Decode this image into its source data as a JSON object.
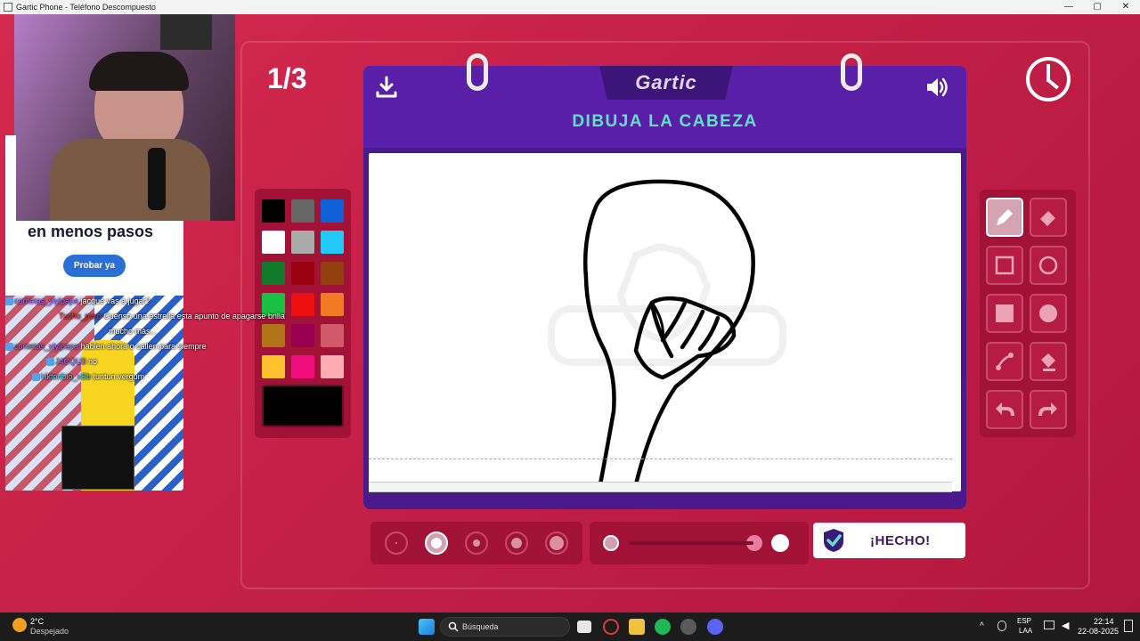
{
  "window": {
    "title": "Gartic Phone - Teléfono Descompuesto",
    "minimize": "—",
    "maximize": "▢",
    "close": "✕"
  },
  "game": {
    "round": "1/3",
    "logo": "Gartic",
    "prompt": "DIBUJA LA CABEZA",
    "done_label": "¡HECHO!",
    "colors": {
      "palette": [
        "#000000",
        "#666666",
        "#1060d8",
        "#ffffff",
        "#aaaaaa",
        "#22c8f8",
        "#117a2a",
        "#990010",
        "#92400e",
        "#19c042",
        "#ee1010",
        "#f37a24",
        "#b07318",
        "#9a0050",
        "#d05a6a",
        "#fdc22c",
        "#f00d7d",
        "#fdacb4"
      ],
      "selected": "#000000",
      "accent": "#c41f49",
      "prompt_color": "#61e0c8"
    },
    "tools": [
      "pencil-icon",
      "eraser-icon",
      "rectangle-outline-icon",
      "circle-outline-icon",
      "rectangle-filled-icon",
      "circle-filled-icon",
      "line-icon",
      "fill-bucket-icon",
      "undo-icon",
      "redo-icon"
    ],
    "active_tool": "pencil-icon",
    "brush_sizes": [
      "xs",
      "s",
      "m",
      "l",
      "xl"
    ],
    "brush_size_selected": 1,
    "opacity": 1.0
  },
  "overlay": {
    "ad_title": "en menos pasos",
    "ad_button": "Probar ya",
    "chat": [
      {
        "user": "contetas_ylylpapa",
        "msg": "jacque vas a jugar?",
        "color": "#b070ff"
      },
      {
        "user": "Tucho_puro",
        "msg": "Cuenso una estrella esta apunto de apagarse brilla",
        "color": "#ff3030"
      },
      {
        "user": "",
        "msg": "mucho más...",
        "color": "#ff3030"
      },
      {
        "user": "contetas_ylylpapa",
        "msg": "hablen ahora o callen para siempre",
        "color": "#b070ff"
      },
      {
        "user": "J4CQU3",
        "msg": "no",
        "color": "#9a78ff"
      },
      {
        "user": "Hktoribio_xSb",
        "msg": "tuntun vergum",
        "color": "#3ad0ff"
      }
    ]
  },
  "taskbar": {
    "weather_temp": "2°C",
    "weather_desc": "Despejado",
    "search_placeholder": "Búsqueda",
    "lang": "ESP",
    "layout": "LAA",
    "time": "22:14",
    "date": "22-08-2025"
  }
}
